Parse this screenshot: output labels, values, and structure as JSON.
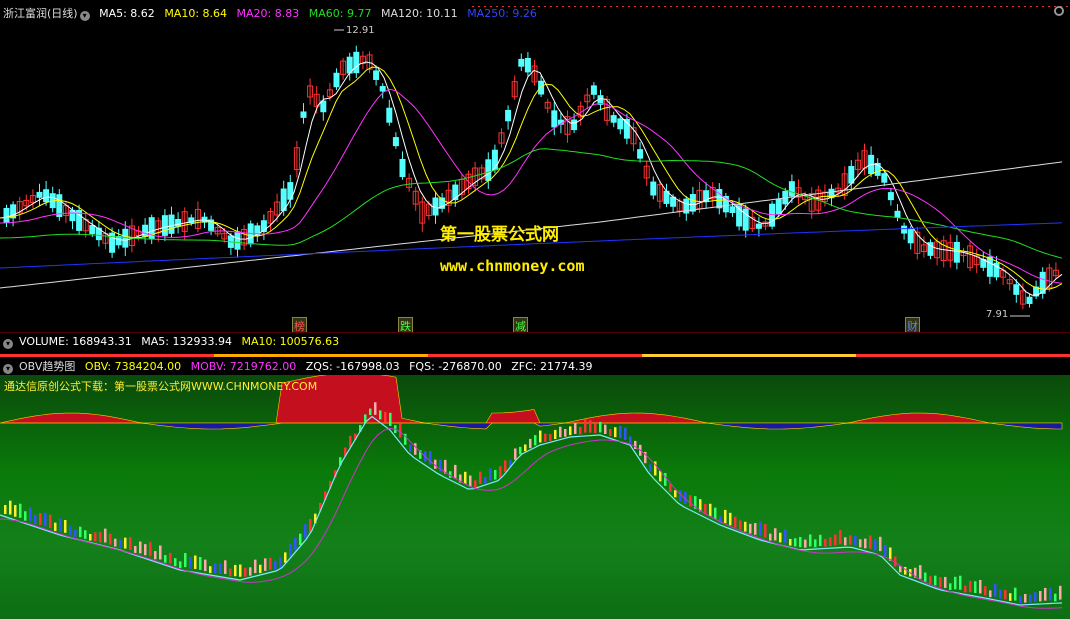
{
  "top_panel": {
    "stock_title": "浙江富润(日线)",
    "ma5": "MA5: 8.62",
    "ma10": "MA10: 8.64",
    "ma20": "MA20: 8.83",
    "ma60": "MA60: 9.77",
    "ma120": "MA120: 10.11",
    "ma250": "MA250: 9.26",
    "high_label": "12.91",
    "low_label": "7.91",
    "event_tags": [
      "榜",
      "跌",
      "减",
      "财"
    ],
    "watermark_cn": "第一股票公式网",
    "watermark_url": "www.chnmoney.com"
  },
  "volume_panel": {
    "volume": "VOLUME: 168943.31",
    "ma5": "MA5: 132933.94",
    "ma10": "MA10: 100576.63"
  },
  "obv_panel": {
    "title": "OBV趋势图",
    "obv": "OBV: 7384204.00",
    "mobv": "MOBV: 7219762.00",
    "zqs": "ZQS: -167998.03",
    "fqs": "FQS: -276870.00",
    "zfc": "ZFC: 21774.39",
    "note": "通达信原创公式下载：第一股票公式网WWW.CHNMONEY.COM"
  },
  "colors": {
    "up": "#ff3232",
    "down": "#54ffff",
    "ma5": "#ffffff",
    "ma10": "#ffff00",
    "ma20": "#ff33ff",
    "ma60": "#22dd22",
    "ma120": "#dddddd",
    "ma250": "#2233ff"
  }
}
